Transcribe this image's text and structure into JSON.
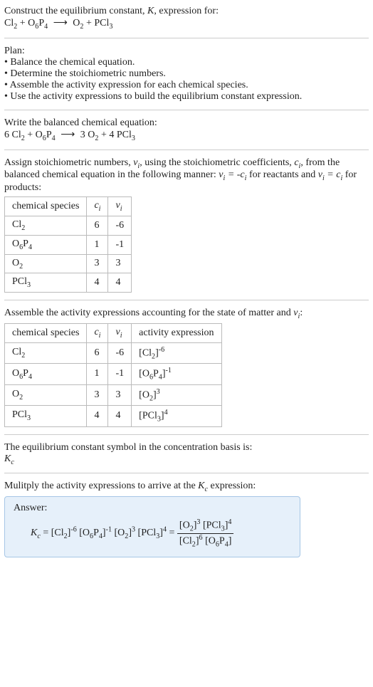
{
  "intro": {
    "line1_a": "Construct the equilibrium constant, ",
    "line1_b": ", expression for:"
  },
  "plan": {
    "heading": "Plan:",
    "b1": "• Balance the chemical equation.",
    "b2": "• Determine the stoichiometric numbers.",
    "b3": "• Assemble the activity expression for each chemical species.",
    "b4": "• Use the activity expressions to build the equilibrium constant expression."
  },
  "balanced_heading": "Write the balanced chemical equation:",
  "stoich_text_a": "Assign stoichiometric numbers, ",
  "stoich_text_b": ", using the stoichiometric coefficients, ",
  "stoich_text_c": ", from the balanced chemical equation in the following manner: ",
  "stoich_text_d": " for reactants and ",
  "stoich_text_e": " for products:",
  "table_headers": {
    "species": "chemical species",
    "ci": "c",
    "vi": "ν",
    "activity": "activity expression"
  },
  "species": {
    "cl2_c": "6",
    "cl2_v": "-6",
    "o6p4_c": "1",
    "o6p4_v": "-1",
    "o2_c": "3",
    "o2_v": "3",
    "pcl3_c": "4",
    "pcl3_v": "4"
  },
  "assemble_text_a": "Assemble the activity expressions accounting for the state of matter and ",
  "assemble_text_b": ":",
  "kc_symbol_text": "The equilibrium constant symbol in the concentration basis is:",
  "multiply_text_a": "Mulitply the activity expressions to arrive at the ",
  "multiply_text_b": " expression:",
  "answer_label": "Answer:",
  "coeffs": {
    "cl2_bal": "6",
    "o2_bal": "3",
    "pcl3_bal": "4"
  }
}
